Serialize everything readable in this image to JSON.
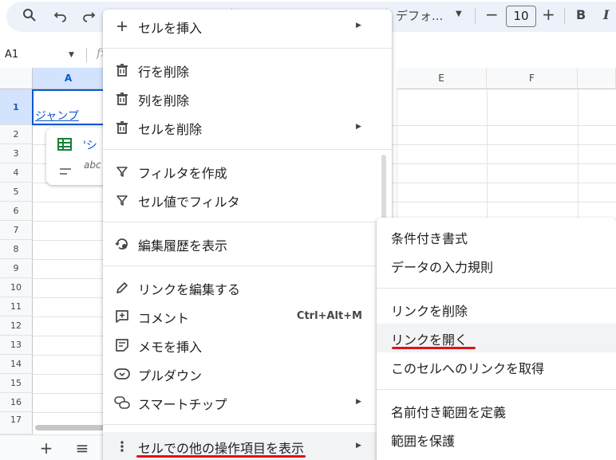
{
  "toolbar": {
    "font_name": "デフォ...",
    "font_size": "10",
    "bold_label": "B",
    "italic_label": "I",
    "minus_label": "−",
    "plus_label": "+"
  },
  "formula_bar": {
    "name_box": "A1",
    "fx_label": "fx"
  },
  "grid": {
    "columns": [
      "A",
      "E",
      "F"
    ],
    "rows": [
      "1",
      "2",
      "3",
      "4",
      "5",
      "6",
      "7",
      "8",
      "9",
      "10",
      "11",
      "12",
      "13",
      "14",
      "15",
      "16",
      "17"
    ],
    "cell_a1": "ジャンプ"
  },
  "chip": {
    "title": "'シ",
    "subtitle": "abc"
  },
  "context_menu": {
    "items": [
      {
        "label": "セルを挿入",
        "icon": "plus-icon",
        "has_submenu": true
      },
      {
        "label": "行を削除",
        "icon": "trash-icon"
      },
      {
        "label": "列を削除",
        "icon": "trash-icon"
      },
      {
        "label": "セルを削除",
        "icon": "trash-icon",
        "has_submenu": true
      },
      {
        "label": "フィルタを作成",
        "icon": "filter-icon"
      },
      {
        "label": "セル値でフィルタ",
        "icon": "filter-icon"
      },
      {
        "label": "編集履歴を表示",
        "icon": "history-icon"
      },
      {
        "label": "リンクを編集する",
        "icon": "pencil-icon"
      },
      {
        "label": "コメント",
        "icon": "comment-icon",
        "shortcut": "Ctrl+Alt+M"
      },
      {
        "label": "メモを挿入",
        "icon": "note-icon"
      },
      {
        "label": "プルダウン",
        "icon": "dropdown-chip-icon"
      },
      {
        "label": "スマートチップ",
        "icon": "smart-chip-icon",
        "has_submenu": true
      },
      {
        "label": "セルでの他の操作項目を表示",
        "icon": "more-vert-icon",
        "has_submenu": true
      }
    ]
  },
  "submenu": {
    "items": [
      {
        "label": "条件付き書式"
      },
      {
        "label": "データの入力規則"
      },
      {
        "label": "リンクを削除"
      },
      {
        "label": "リンクを開く"
      },
      {
        "label": "このセルへのリンクを取得"
      },
      {
        "label": "名前付き範囲を定義"
      },
      {
        "label": "範囲を保護"
      }
    ]
  },
  "bottom_bar": {
    "add_sheet": "+",
    "all_sheets": "≡"
  },
  "colors": {
    "accent": "#0b57d0",
    "link": "#1155cc",
    "annotation_red": "#e0101b",
    "toolbar_bg": "#edf2fa"
  }
}
